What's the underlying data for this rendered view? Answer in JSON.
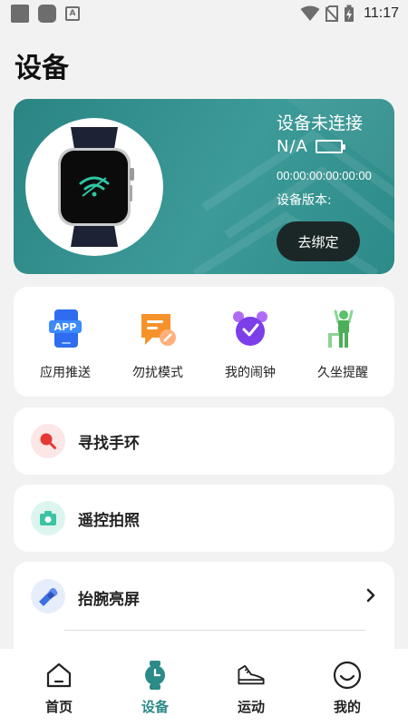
{
  "status_bar": {
    "time": "11:17",
    "notification_glyph": "A"
  },
  "page": {
    "title": "设备"
  },
  "device": {
    "connection_status": "设备未连接",
    "battery": "N/A",
    "mac_address": "00:00:00:00:00:00",
    "firmware_label": "设备版本:",
    "unbind_label": "去绑定"
  },
  "functions": [
    {
      "label": "应用推送",
      "icon": "app-push-icon",
      "icon_text": "APP"
    },
    {
      "label": "勿扰模式",
      "icon": "do-not-disturb-icon"
    },
    {
      "label": "我的闹钟",
      "icon": "alarm-clock-icon"
    },
    {
      "label": "久坐提醒",
      "icon": "sedentary-reminder-icon"
    }
  ],
  "rows": {
    "find": {
      "label": "寻找手环",
      "icon": "search-icon"
    },
    "camera": {
      "label": "遥控拍照",
      "icon": "camera-icon"
    },
    "wrist": {
      "label": "抬腕亮屏",
      "icon": "wrist-raise-icon"
    }
  },
  "nav": [
    {
      "label": "首页",
      "icon": "home-icon"
    },
    {
      "label": "设备",
      "icon": "watch-icon",
      "active": true
    },
    {
      "label": "运动",
      "icon": "shoe-icon"
    },
    {
      "label": "我的",
      "icon": "profile-icon"
    }
  ],
  "colors": {
    "accent": "#2c8a88",
    "card_bg": "#3a9896",
    "page_bg": "#f2f2f2"
  }
}
